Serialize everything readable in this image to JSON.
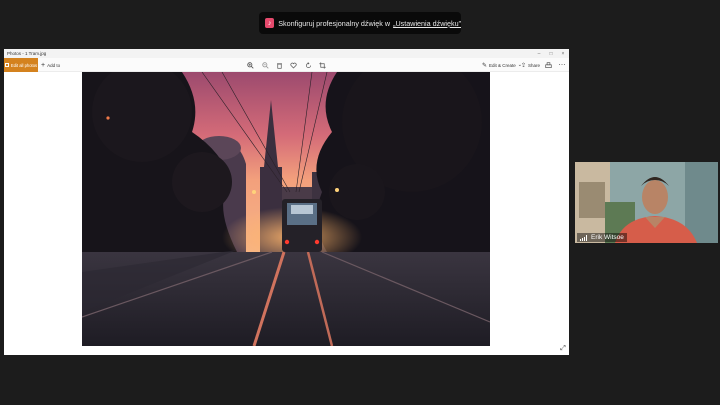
{
  "toast": {
    "icon": "speaker-settings-icon",
    "message": "Skonfiguruj profesjonalny dźwięk w",
    "link": "„Ustawienia dźwięku”"
  },
  "window": {
    "title": "Photos - 1 Tram.jpg",
    "toolbar": {
      "edit_label": "Edit all photos",
      "add_label": "Add to",
      "edit_create_label": "Edit & Create",
      "share_label": "Share"
    }
  },
  "participant": {
    "name": "Erik Witsoe"
  },
  "colors": {
    "meeting_bg": "#1c1c1c",
    "edit_button": "#d4821e",
    "sky_top": "#a54d6b",
    "sky_horizon": "#f3a07c"
  }
}
